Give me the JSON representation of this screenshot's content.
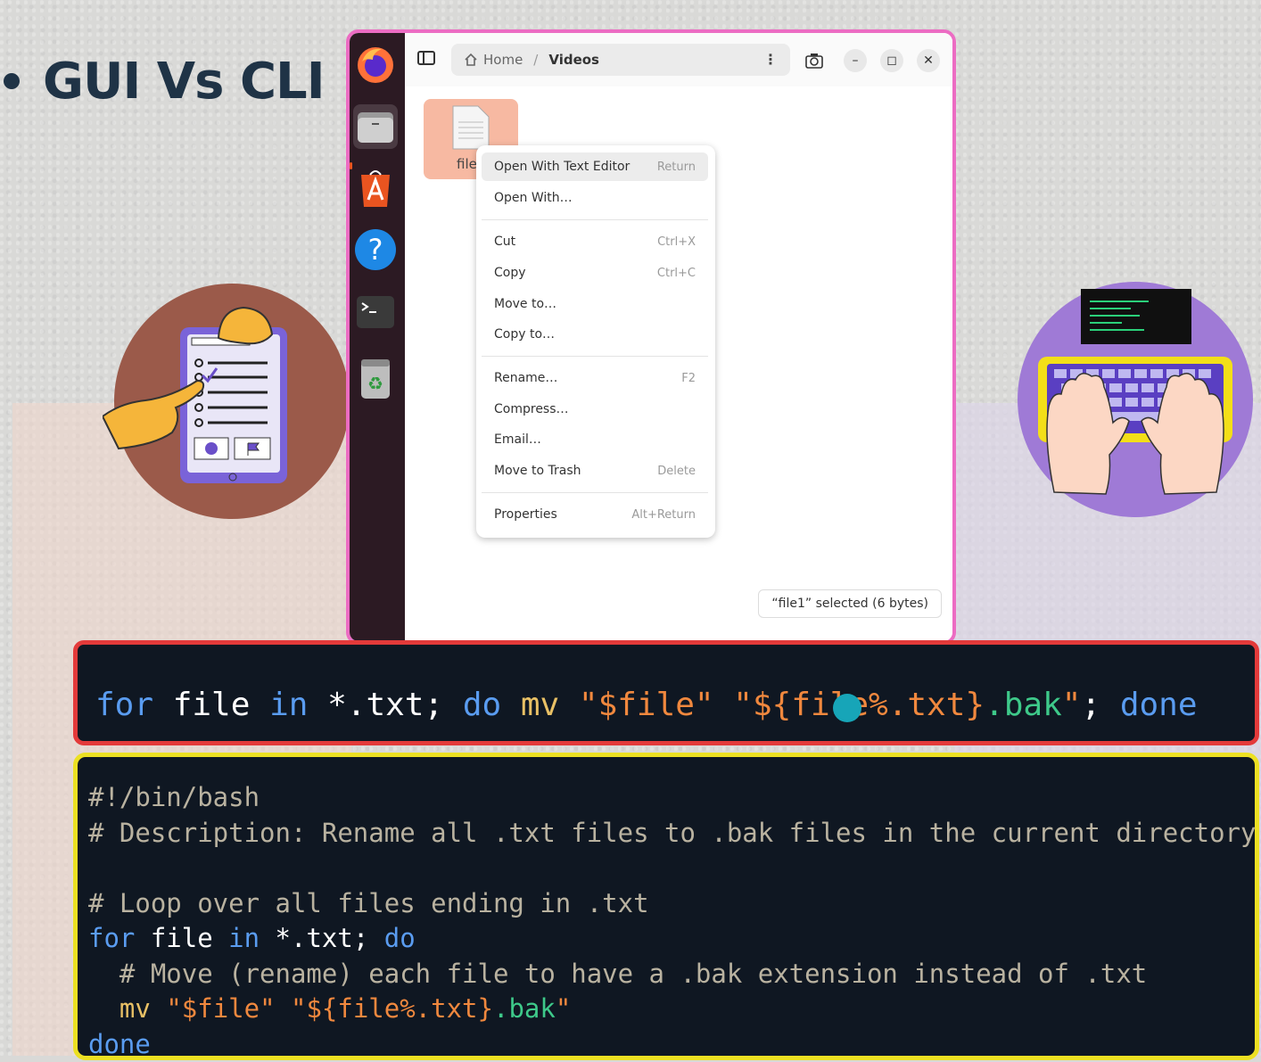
{
  "slide": {
    "title": "GUI Vs CLI"
  },
  "file_manager": {
    "breadcrumb": {
      "home": "Home",
      "separator": "/",
      "current": "Videos"
    },
    "file_label": "file",
    "status": "“file1” selected  (6 bytes)",
    "context_menu": {
      "open_text_editor": {
        "label": "Open With Text Editor",
        "accel": "Return"
      },
      "open_with": {
        "label": "Open With…"
      },
      "cut": {
        "label": "Cut",
        "accel": "Ctrl+X"
      },
      "copy": {
        "label": "Copy",
        "accel": "Ctrl+C"
      },
      "move_to": {
        "label": "Move to…"
      },
      "copy_to": {
        "label": "Copy to…"
      },
      "rename": {
        "label": "Rename…",
        "accel": "F2"
      },
      "compress": {
        "label": "Compress…"
      },
      "email": {
        "label": "Email…"
      },
      "trash": {
        "label": "Move to Trash",
        "accel": "Delete"
      },
      "properties": {
        "label": "Properties",
        "accel": "Alt+Return"
      }
    }
  },
  "cli_oneliner": {
    "for": "for",
    "file": " file ",
    "in": "in",
    "glob": " *.txt; ",
    "do": "do",
    "mv": " mv ",
    "arg1": "\"$file\"",
    "space": " ",
    "arg2a": "\"${file%.txt}",
    "arg2b": ".bak",
    "arg2c": "\"",
    "semi": "; ",
    "done": "done"
  },
  "script": {
    "l1": "#!/bin/bash",
    "l2": "# Description: Rename all .txt files to .bak files in the current directory",
    "l4": "# Loop over all files ending in .txt",
    "l5_for": "for",
    "l5_mid": " file ",
    "l5_in": "in",
    "l5_rest": " *.txt; ",
    "l5_do": "do",
    "l6": "  # Move (rename) each file to have a .bak extension instead of .txt",
    "l7_mv": "  mv ",
    "l7_a1": "\"$file\"",
    "l7_sp": " ",
    "l7_a2": "\"${file%.txt}",
    "l7_bak": ".bak",
    "l7_q": "\"",
    "l8": "done"
  },
  "colors": {
    "title": "#1f3346",
    "ubuntu_border": "#ec6cc3",
    "cli_border": "#e33a3a",
    "script_border": "#ece022"
  },
  "icons": [
    "firefox-icon",
    "files-icon",
    "app-center-icon",
    "help-icon",
    "terminal-icon",
    "trash-icon",
    "home-icon",
    "sidebar-toggle-icon",
    "screenshot-icon",
    "minimize-icon",
    "maximize-icon",
    "close-icon"
  ]
}
